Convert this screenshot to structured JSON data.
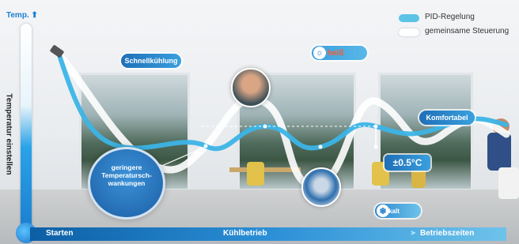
{
  "axis": {
    "temp_label": "Temp.",
    "vertical_label": "Temperatur einstellen",
    "start_label": "Starten",
    "middle_label": "Kühlbetrieb",
    "end_label": "Betriebszeiten"
  },
  "legend": {
    "pid_label": "PID-Regelung",
    "common_label": "gemeinsame Steuerung",
    "pid_color": "#5bc3e6",
    "common_color": "#ffffff"
  },
  "callouts": {
    "schnellkuehlung": "Schnellkühlung",
    "zu_heiss": "zu heiß",
    "komfortabel": "Komfortabel",
    "accuracy": "±0.5°C",
    "zu_kalt": "zu kalt",
    "fluctuation": "geringere\nTemperatursch-\nwankungen"
  },
  "icons": {
    "temp_arrow": "arrow-up-icon",
    "sun": "sun-icon",
    "snowflake": "snowflake-icon",
    "end_arrow": "arrow-right-icon"
  },
  "colors": {
    "hot": "#ff5a2c",
    "bar": "#1f78c8"
  }
}
